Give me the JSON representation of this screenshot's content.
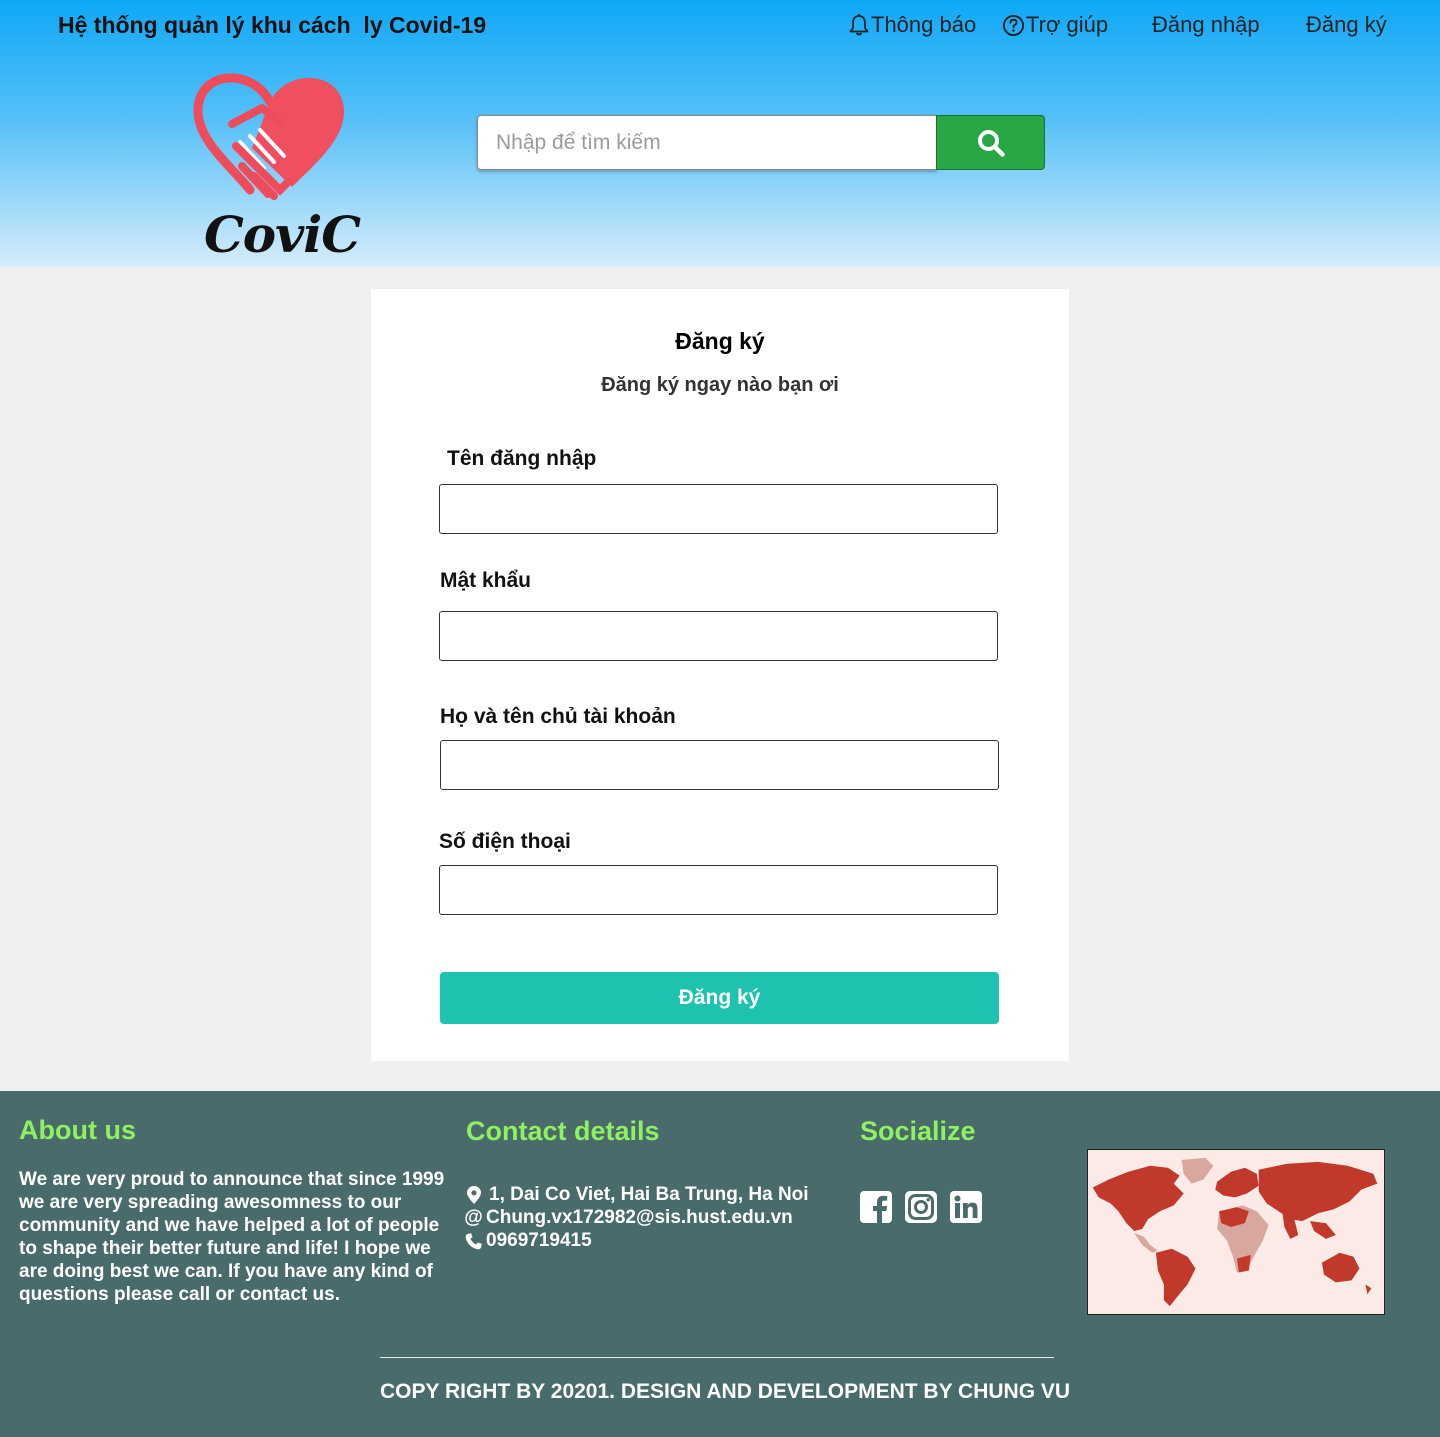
{
  "header": {
    "site_title": "Hệ thống quản lý khu cách  ly Covid-19",
    "nav": {
      "notifications": "Thông báo",
      "help": "Trợ giúp",
      "login": "Đăng nhập",
      "register": "Đăng ký"
    },
    "brand": "CoviC",
    "search": {
      "placeholder": "Nhập để tìm kiếm"
    }
  },
  "form": {
    "title": "Đăng ký",
    "subtitle": "Đăng ký ngay nào bạn ơi",
    "fields": {
      "username": {
        "label": "Tên đăng nhập",
        "value": ""
      },
      "password": {
        "label": "Mật khẩu",
        "value": ""
      },
      "fullname": {
        "label": "Họ và tên chủ tài khoản",
        "value": ""
      },
      "phone": {
        "label": "Số điện thoại",
        "value": ""
      }
    },
    "submit_label": "Đăng ký"
  },
  "footer": {
    "about": {
      "heading": "About us",
      "text": "We are very proud to announce that since 1999 we are very spreading awesomness to our community and we have helped a lot of people to shape their better future and life! I hope we are doing best we can. If you have any kind of questions please call or contact us."
    },
    "contact": {
      "heading": "Contact details",
      "address": "1, Dai Co Viet, Hai Ba Trung, Ha Noi",
      "email": "Chung.vx172982@sis.hust.edu.vn",
      "phone": "0969719415"
    },
    "social": {
      "heading": "Socialize",
      "icons": [
        "facebook-icon",
        "instagram-icon",
        "linkedin-icon"
      ]
    },
    "copyright": "COPY RIGHT BY 20201. DESIGN AND DEVELOPMENT BY CHUNG VU"
  },
  "colors": {
    "header_top": "#0fa8f7",
    "search_button": "#28a745",
    "submit_button": "#1ec2af",
    "footer_bg": "#4a6b6b",
    "footer_heading": "#8ff060",
    "map_fill": "#c0392b"
  }
}
